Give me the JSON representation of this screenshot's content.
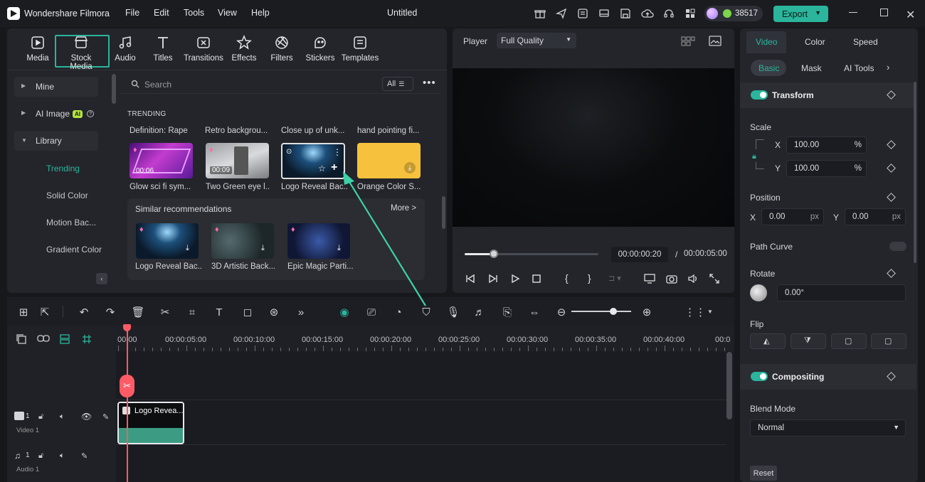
{
  "app": {
    "name": "Wondershare Filmora",
    "doc_title": "Untitled",
    "credits": "38517",
    "export_label": "Export"
  },
  "menu": [
    "File",
    "Edit",
    "Tools",
    "View",
    "Help"
  ],
  "media_tabs": [
    {
      "label": "Media",
      "icon": "media-icon"
    },
    {
      "label": "Stock Media",
      "icon": "stock-media-icon",
      "active": true
    },
    {
      "label": "Audio",
      "icon": "audio-icon"
    },
    {
      "label": "Titles",
      "icon": "titles-icon"
    },
    {
      "label": "Transitions",
      "icon": "transitions-icon"
    },
    {
      "label": "Effects",
      "icon": "effects-icon"
    },
    {
      "label": "Filters",
      "icon": "filters-icon"
    },
    {
      "label": "Stickers",
      "icon": "stickers-icon"
    },
    {
      "label": "Templates",
      "icon": "templates-icon"
    }
  ],
  "sidebar": {
    "mine": "Mine",
    "ai_image": "AI Image",
    "ai_badge": "AI",
    "library": "Library",
    "sub": [
      "Trending",
      "Solid Color",
      "Motion Bac...",
      "Gradient Color"
    ]
  },
  "search": {
    "placeholder": "Search",
    "filter": "All"
  },
  "trending": {
    "heading": "TRENDING",
    "top_titles": [
      "Definition: Rape",
      "Retro backgrou...",
      "Close up of unk...",
      "hand pointing fi..."
    ],
    "items": [
      {
        "caption": "Glow sci fi sym...",
        "duration": "00:06"
      },
      {
        "caption": "Two Green eye l...",
        "duration": "00:09"
      },
      {
        "caption": "Logo Reveal Bac...",
        "duration": ""
      },
      {
        "caption": "Orange Color S...",
        "duration": ""
      }
    ]
  },
  "similar": {
    "title": "Similar recommendations",
    "more": "More >",
    "items": [
      "Logo Reveal Bac...",
      "3D Artistic Back...",
      "Epic Magic Parti..."
    ]
  },
  "player": {
    "label": "Player",
    "quality": "Full Quality",
    "current": "00:00:00:20",
    "separator": "/",
    "total": "00:00:05:00",
    "progress": 0.22
  },
  "timeline": {
    "ruler": [
      "00:00",
      "00:00:05:00",
      "00:00:10:00",
      "00:00:15:00",
      "00:00:20:00",
      "00:00:25:00",
      "00:00:30:00",
      "00:00:35:00",
      "00:00:40:00",
      "00:0"
    ],
    "clip": "Logo Revea...",
    "video_track": "Video 1",
    "video_num": "1",
    "audio_track": "Audio 1",
    "audio_num": "1",
    "zoom": 0.7
  },
  "right": {
    "tabs": [
      "Video",
      "Color",
      "Speed"
    ],
    "subtabs": [
      "Basic",
      "Mask",
      "AI Tools"
    ],
    "transform": "Transform",
    "scale": "Scale",
    "x": "X",
    "y": "Y",
    "scale_x": "100.00",
    "scale_y": "100.00",
    "pct": "%",
    "position": "Position",
    "pos_x": "0.00",
    "pos_y": "0.00",
    "px": "px",
    "path_curve": "Path Curve",
    "rotate": "Rotate",
    "rotate_val": "0.00°",
    "flip": "Flip",
    "compositing": "Compositing",
    "blend": "Blend Mode",
    "blend_val": "Normal",
    "reset": "Reset"
  },
  "colors": {
    "accent": "#2ab59c",
    "bg": "#17181c",
    "panel": "#23252b",
    "playhead": "#ff5b66"
  }
}
